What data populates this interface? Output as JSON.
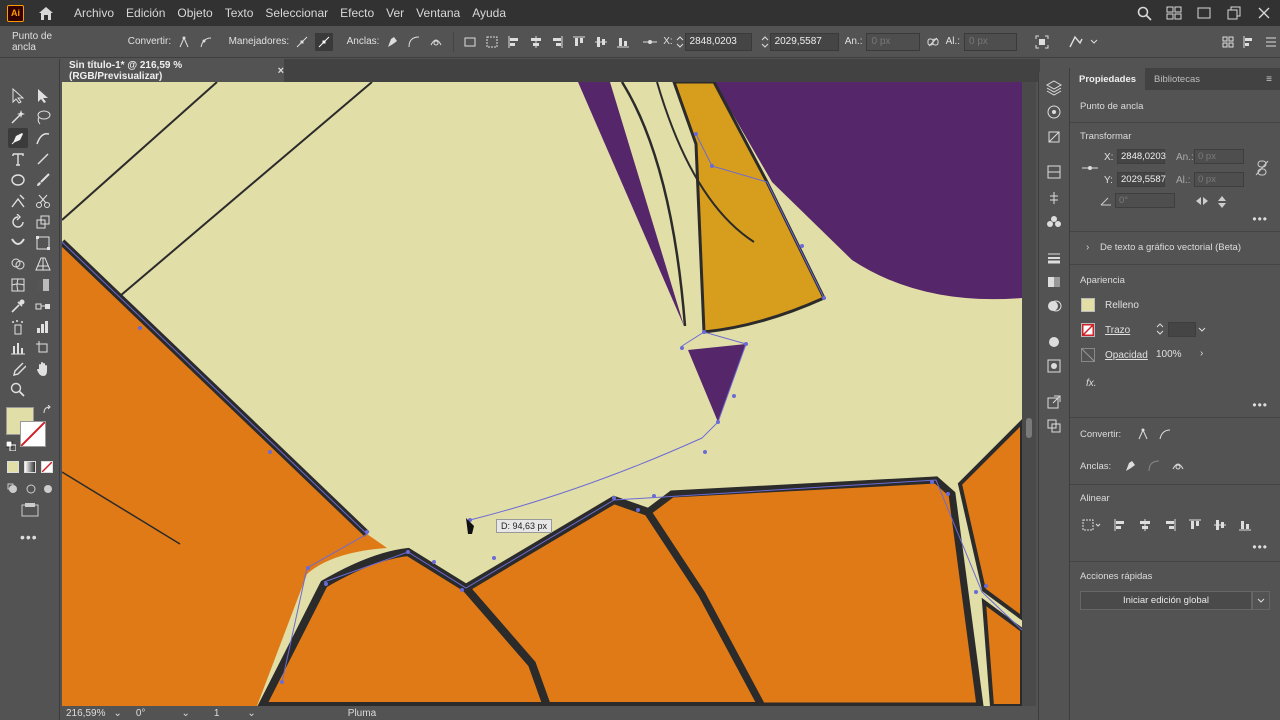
{
  "app": {
    "logo": "Ai"
  },
  "menus": [
    "Archivo",
    "Edición",
    "Objeto",
    "Texto",
    "Seleccionar",
    "Efecto",
    "Ver",
    "Ventana",
    "Ayuda"
  ],
  "control": {
    "selection_label": "Punto de ancla",
    "convert_label": "Convertir:",
    "handles_label": "Manejadores:",
    "anchors_label": "Anclas:",
    "x_label": "X:",
    "x_value": "2848,0203",
    "y_label": "Y:",
    "y_value": "2029,5587",
    "w_label": "An.:",
    "w_value": "0 px",
    "h_label": "Al.:",
    "h_value": "0 px"
  },
  "document_tab": {
    "title": "Sin título-1* @ 216,59 % (RGB/Previsualizar)",
    "close": "×"
  },
  "canvas": {
    "colors": {
      "cream": "#e2dea7",
      "orange": "#e07a17",
      "purple": "#55266a",
      "gold": "#d79d1c",
      "stroke": "#2b2b2b",
      "path": "#6b6bd6"
    },
    "tooltip": "D: 94,63 px"
  },
  "status": {
    "zoom": "216,59%",
    "rotation": "0°",
    "artboard": "1",
    "tool": "Pluma"
  },
  "panel": {
    "tabs": [
      "Propiedades",
      "Bibliotecas"
    ],
    "selection": "Punto de ancla",
    "transform_title": "Transformar",
    "x_label": "X:",
    "x_value": "2848,0203",
    "y_label": "Y:",
    "y_value": "2029,5587",
    "w_label": "An.:",
    "w_value": "0 px",
    "h_label": "Al.:",
    "h_value": "0 px",
    "angle_value": "0°",
    "text_to_vector": "De texto a gráfico vectorial (Beta)",
    "appearance_title": "Apariencia",
    "fill_label": "Relleno",
    "fill_color": "#e2dea7",
    "stroke_label": "Trazo",
    "opacity_label": "Opacidad",
    "opacity_value": "100%",
    "convert_label": "Convertir:",
    "anchors_label": "Anclas:",
    "align_title": "Alinear",
    "quick_actions_title": "Acciones rápidas",
    "global_edit_button": "Iniciar edición global",
    "more": "•••"
  }
}
